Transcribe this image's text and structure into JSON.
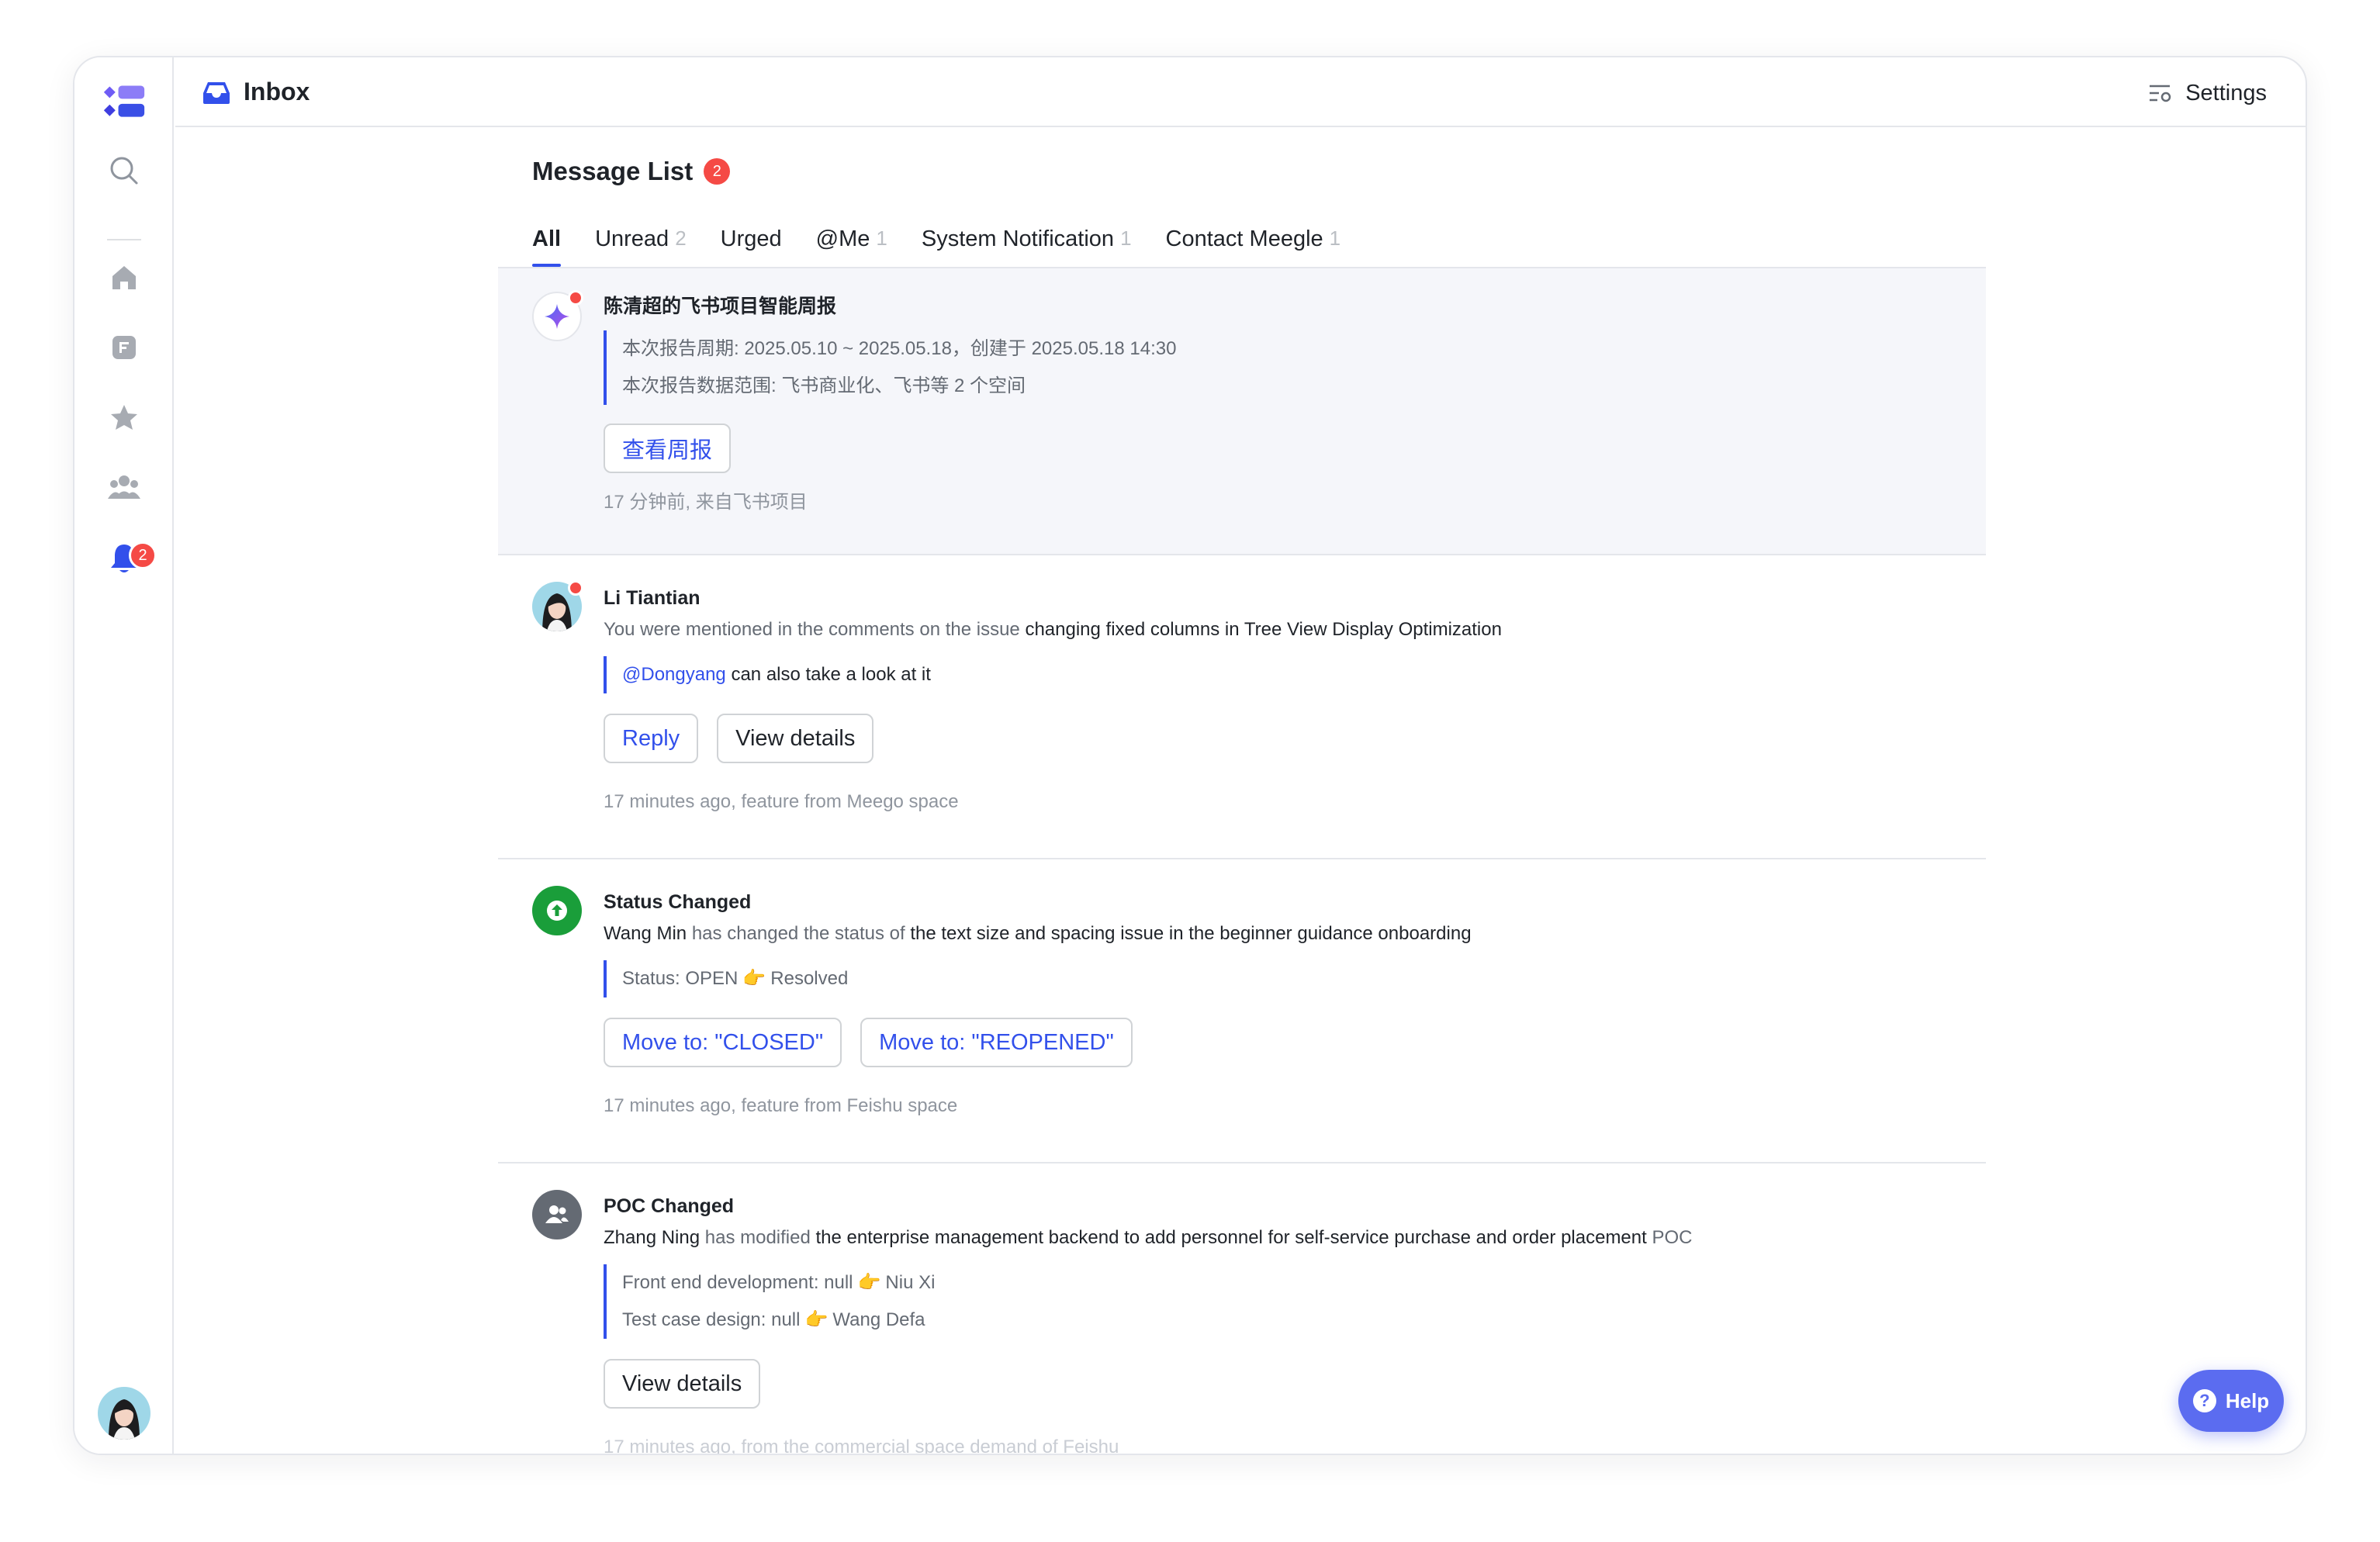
{
  "header": {
    "title": "Inbox",
    "settings_label": "Settings"
  },
  "sidebar": {
    "notification_badge": "2"
  },
  "message_list": {
    "title": "Message List",
    "badge": "2"
  },
  "tabs": [
    {
      "label": "All",
      "count": ""
    },
    {
      "label": "Unread",
      "count": "2"
    },
    {
      "label": "Urged",
      "count": ""
    },
    {
      "label": "@Me",
      "count": "1"
    },
    {
      "label": "System Notification",
      "count": "1"
    },
    {
      "label": "Contact Meegle",
      "count": "1"
    }
  ],
  "messages": [
    {
      "sender": "陈清超的飞书项目智能周报",
      "quote": [
        "本次报告周期: 2025.05.10 ~ 2025.05.18，创建于 2025.05.18 14:30",
        "本次报告数据范围: 飞书商业化、飞书等 2 个空间"
      ],
      "button": "查看周报",
      "meta": "17 分钟前, 来自飞书项目"
    },
    {
      "sender": "Li Tiantian",
      "text_prefix": "You were mentioned in the comments on the issue ",
      "text_strong": "changing fixed columns in Tree View Display Optimization",
      "quote_mention": "@Dongyang",
      "quote_rest": " can also take a look at it",
      "buttons": [
        "Reply",
        "View details"
      ],
      "meta": "17 minutes ago, feature from Meego space"
    },
    {
      "sender": "Status Changed",
      "actor": "Wang Min",
      "text_mid": " has changed the status of ",
      "text_strong": "the text size and spacing issue in the beginner guidance onboarding",
      "quote_from": "Status: OPEN",
      "quote_to": "Resolved",
      "buttons": [
        "Move to: \"CLOSED\"",
        "Move to: \"REOPENED\""
      ],
      "meta": "17 minutes ago, feature from Feishu space"
    },
    {
      "sender": "POC Changed",
      "actor": "Zhang Ning",
      "text_mid": " has modified ",
      "text_strong": "the enterprise management backend to add personnel for self-service purchase and order placement",
      "text_suffix": " POC",
      "changes": [
        {
          "from": "Front end development: null",
          "to": "Niu Xi"
        },
        {
          "from": "Test case design: null",
          "to": "Wang Defa"
        }
      ],
      "button": "View details",
      "meta": "17 minutes ago, from the commercial space demand of Feishu"
    }
  ],
  "help": {
    "label": "Help"
  },
  "icons": {
    "pointer": "👉",
    "accent": "#3250eb",
    "status_green": "#1a9e3a",
    "badge_red": "#f54a45"
  }
}
